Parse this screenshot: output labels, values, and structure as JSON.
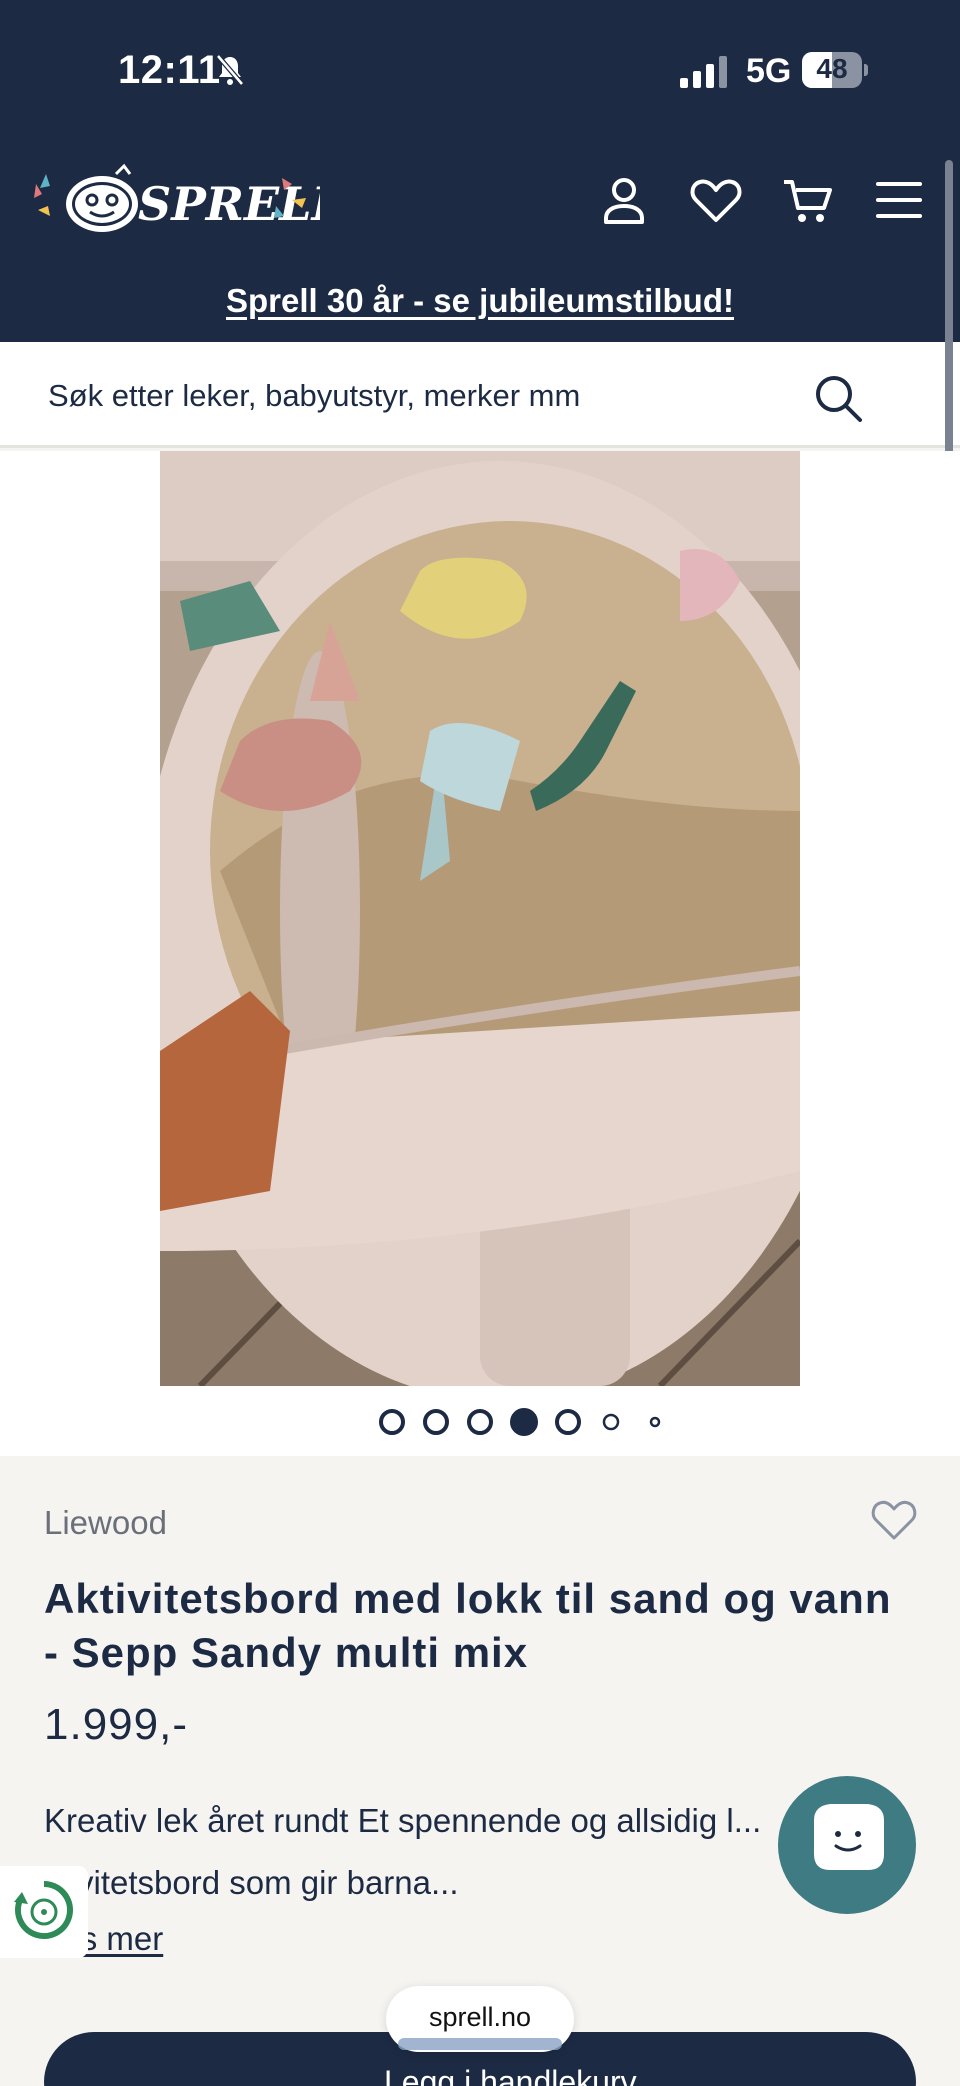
{
  "status_bar": {
    "time": "12:11",
    "network": "5G",
    "battery": "48"
  },
  "header": {
    "logo_text": "SPRELL",
    "icons": [
      "account-icon",
      "heart-icon",
      "cart-icon",
      "menu-icon"
    ],
    "promo": "Sprell 30 år - se jubileumstilbud!"
  },
  "search": {
    "placeholder": "Søk etter leker, babyutstyr, merker mm"
  },
  "gallery": {
    "slide_count": 7,
    "active_slide": 4
  },
  "product": {
    "brand": "Liewood",
    "title": "Aktivitetsbord med lokk til sand og vann - Sepp Sandy multi mix",
    "price": "1.999,-",
    "description": "Kreativ lek året rundt Et spennende og allsidig l... ktivitetsbord som gir barna...",
    "read_more": "Les mer"
  },
  "actions": {
    "add_to_cart": "Legg i handlekurv"
  },
  "browser": {
    "url": "sprell.no"
  },
  "colors": {
    "navy": "#1c2a43",
    "teal": "#3e7b82",
    "background": "#f5f4f1"
  }
}
